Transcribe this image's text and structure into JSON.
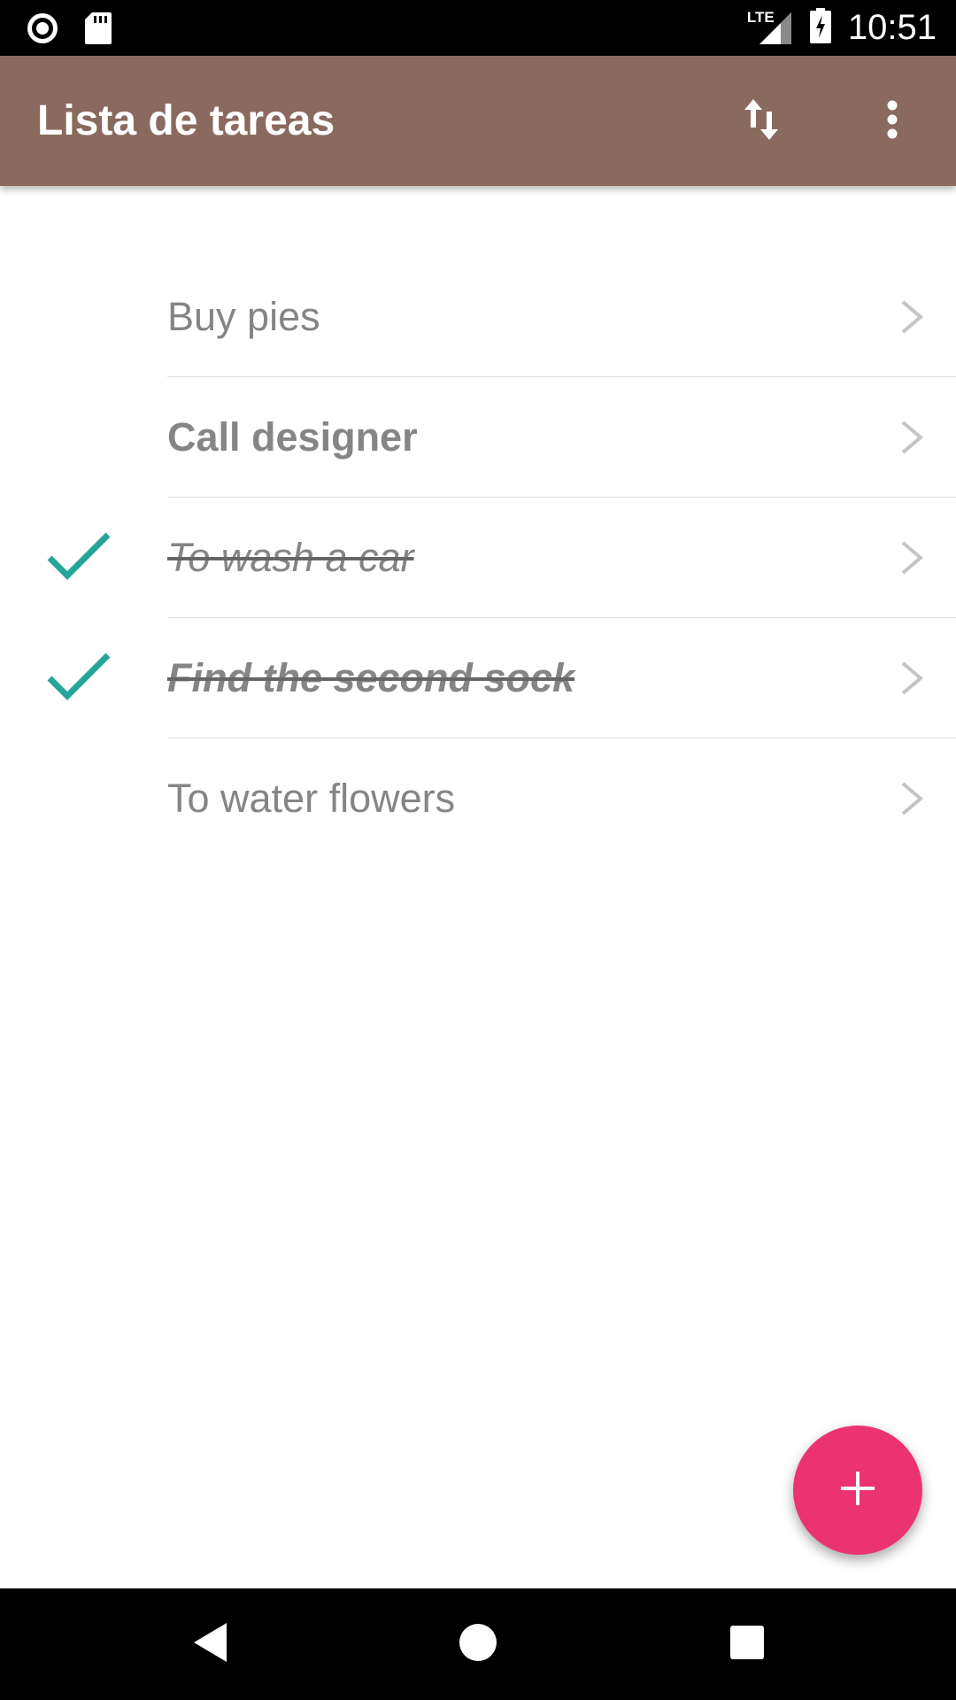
{
  "status_bar": {
    "time": "10:51",
    "network": "LTE",
    "icons": [
      "record-icon",
      "sd-card-icon",
      "signal-icon",
      "battery-charging-icon"
    ]
  },
  "app_bar": {
    "title": "Lista de tareas",
    "background_color": "#8a6a5e",
    "actions": [
      "sort-icon",
      "more-vert-icon"
    ]
  },
  "tasks": [
    {
      "title": "Buy pies",
      "completed": false,
      "bold": false
    },
    {
      "title": "Call designer",
      "completed": false,
      "bold": true
    },
    {
      "title": "To wash a car",
      "completed": true,
      "bold": false
    },
    {
      "title": "Find the second sock",
      "completed": true,
      "bold": true
    },
    {
      "title": "To water flowers",
      "completed": false,
      "bold": false
    }
  ],
  "colors": {
    "check": "#26a69a",
    "fab": "#ec3372",
    "task_text": "#858585"
  },
  "fab": {
    "icon": "add-icon"
  },
  "nav_bar": {
    "icons": [
      "back-icon",
      "home-icon",
      "recents-icon"
    ]
  }
}
